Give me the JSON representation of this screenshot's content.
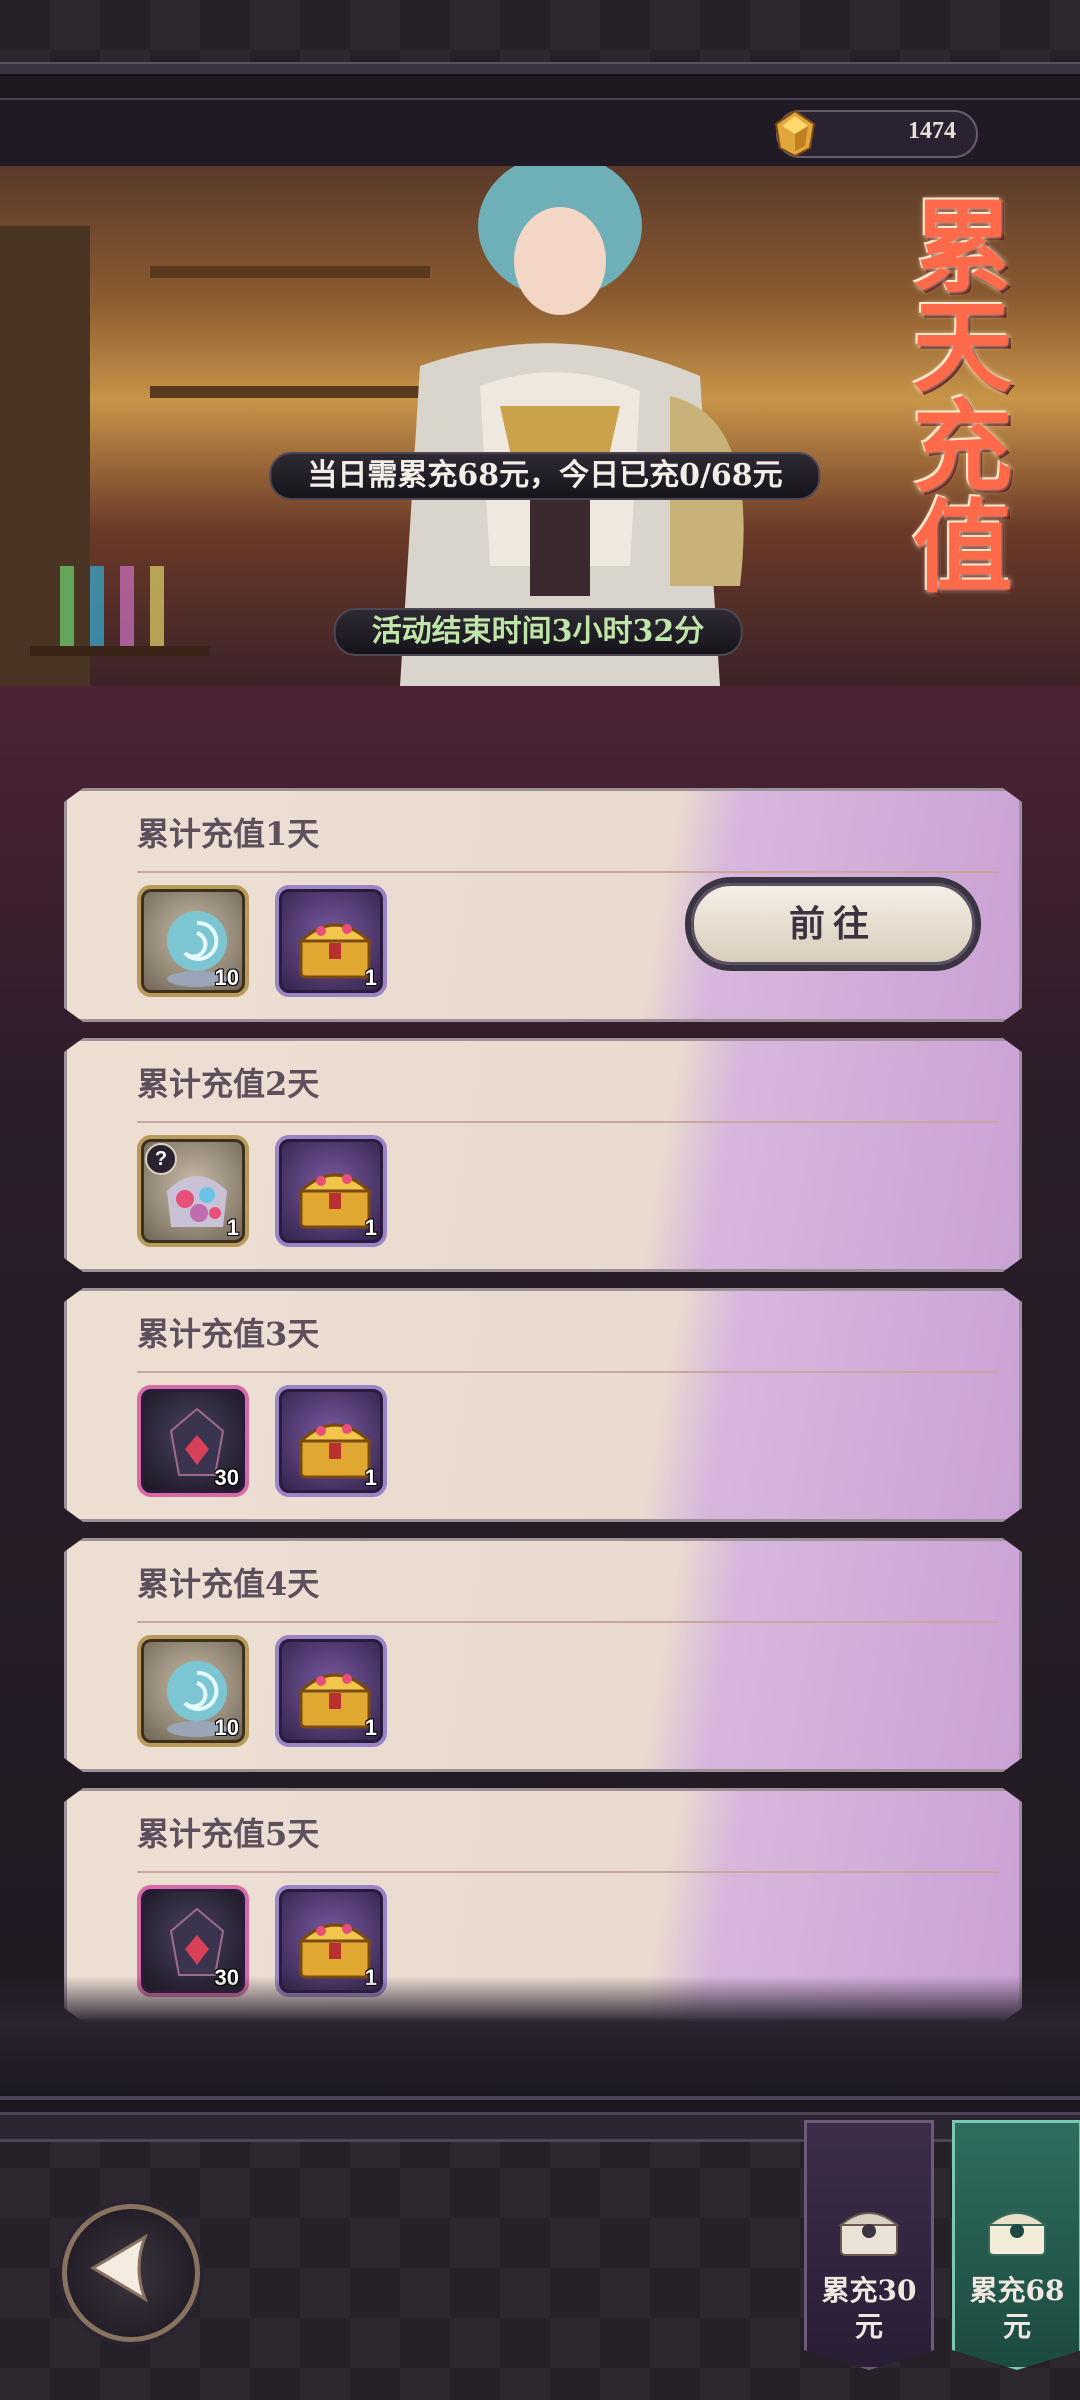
{
  "header": {
    "currency_value": "1474",
    "currency_icon": "gem-icon"
  },
  "banner": {
    "title": "累天充值",
    "requirement_text": "当日需累充68元，今日已充0/68元",
    "end_time_text": "活动结束时间3小时32分"
  },
  "tasks": [
    {
      "title": "累计充值1天",
      "rewards": [
        {
          "icon": "crystal-orb-icon",
          "count": "10"
        },
        {
          "icon": "treasure-chest-icon",
          "count": "1"
        }
      ],
      "action_label": "前往"
    },
    {
      "title": "累计充值2天",
      "rewards": [
        {
          "icon": "mystery-gem-bag-icon",
          "count": "1"
        },
        {
          "icon": "treasure-chest-icon",
          "count": "1"
        }
      ]
    },
    {
      "title": "累计充值3天",
      "rewards": [
        {
          "icon": "dark-crystal-icon",
          "count": "30"
        },
        {
          "icon": "treasure-chest-icon",
          "count": "1"
        }
      ]
    },
    {
      "title": "累计充值4天",
      "rewards": [
        {
          "icon": "crystal-orb-icon",
          "count": "10"
        },
        {
          "icon": "treasure-chest-icon",
          "count": "1"
        }
      ]
    },
    {
      "title": "累计充值5天",
      "rewards": [
        {
          "icon": "dark-crystal-icon",
          "count": "30"
        },
        {
          "icon": "treasure-chest-icon",
          "count": "1"
        }
      ]
    }
  ],
  "tabs": [
    {
      "label_line1": "累充30",
      "label_line2": "元",
      "active": false
    },
    {
      "label_line1": "累充68",
      "label_line2": "元",
      "active": true
    }
  ],
  "colors": {
    "title_red": "#ff6a4a",
    "active_tab": "#2f6d5f",
    "inactive_tab": "#3d2d4a"
  }
}
